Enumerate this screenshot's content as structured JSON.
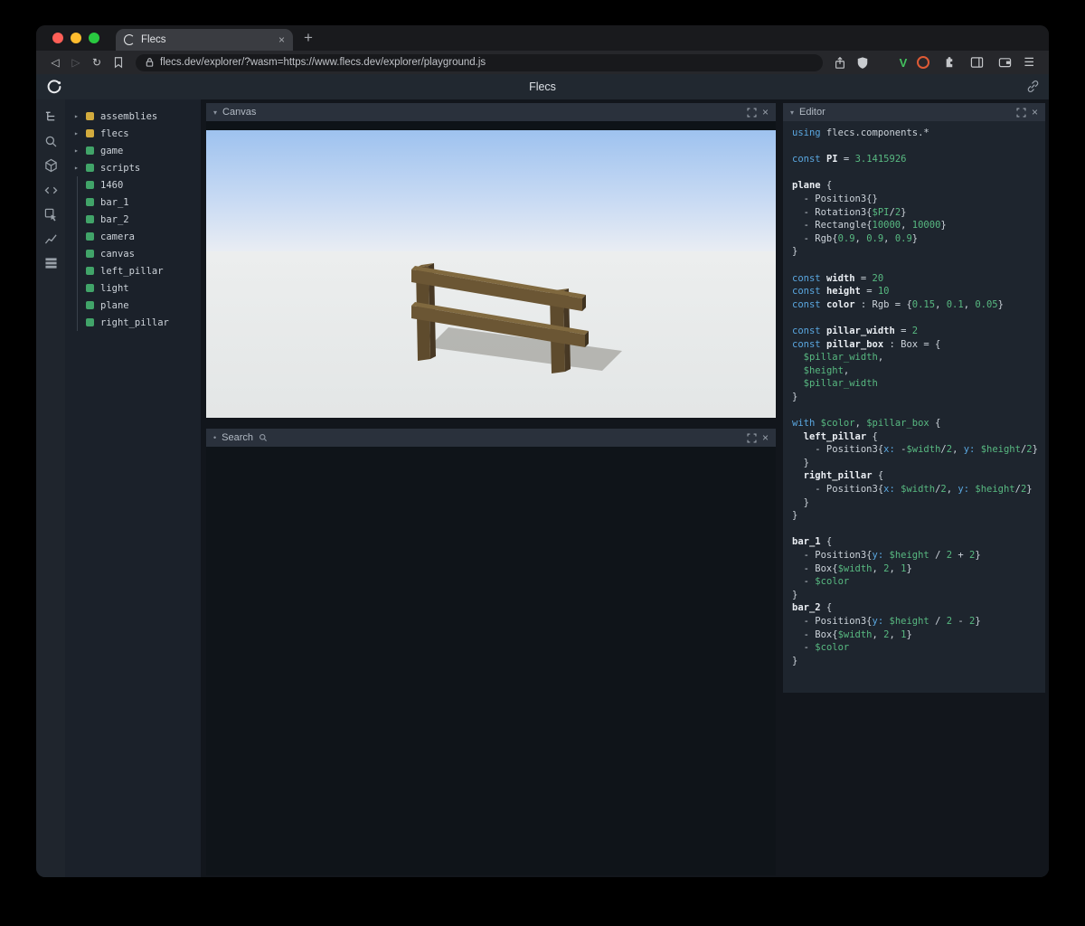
{
  "colors": {
    "module_icon": "#d2ab3e",
    "entity_icon": "#41a469",
    "code_keyword": "#5aa7e0",
    "code_value": "#58b981",
    "sky": "#9ec2ef",
    "ground": "#e9ebeb",
    "wood_front": "#6b5634"
  },
  "browser": {
    "tab_title": "Flecs",
    "url": "flecs.dev/explorer/?wasm=https://www.flecs.dev/explorer/playground.js",
    "icons": {
      "back": "◁",
      "forward": "▷",
      "reload": "↻",
      "new_tab": "+",
      "tab_close": "×",
      "menu": "☰",
      "v_extension": "V"
    }
  },
  "page": {
    "title": "Flecs"
  },
  "panels": {
    "canvas": {
      "title": "Canvas",
      "collapse_icon": "▾",
      "close_icon": "×"
    },
    "search": {
      "title": "Search",
      "bullet_icon": "•",
      "close_icon": "×"
    },
    "editor": {
      "title": "Editor",
      "collapse_icon": "▾",
      "close_icon": "×"
    }
  },
  "tree": {
    "expand_arrow": "▸",
    "items": [
      {
        "label": "assemblies",
        "kind": "module",
        "expandable": true
      },
      {
        "label": "flecs",
        "kind": "module",
        "expandable": true
      },
      {
        "label": "game",
        "kind": "entity",
        "expandable": true
      },
      {
        "label": "scripts",
        "kind": "entity",
        "expandable": true
      },
      {
        "label": "1460",
        "kind": "entity",
        "expandable": false
      },
      {
        "label": "bar_1",
        "kind": "entity",
        "expandable": false
      },
      {
        "label": "bar_2",
        "kind": "entity",
        "expandable": false
      },
      {
        "label": "camera",
        "kind": "entity",
        "expandable": false
      },
      {
        "label": "canvas",
        "kind": "entity",
        "expandable": false
      },
      {
        "label": "left_pillar",
        "kind": "entity",
        "expandable": false
      },
      {
        "label": "light",
        "kind": "entity",
        "expandable": false
      },
      {
        "label": "plane",
        "kind": "entity",
        "expandable": false
      },
      {
        "label": "right_pillar",
        "kind": "entity",
        "expandable": false
      }
    ]
  },
  "editor_code": {
    "lines": [
      [
        [
          "using",
          "k"
        ],
        [
          " flecs.components.*",
          "t"
        ]
      ],
      [],
      [
        [
          "const",
          "k"
        ],
        [
          " ",
          "t"
        ],
        [
          "PI",
          "d"
        ],
        [
          " = ",
          "t"
        ],
        [
          "3.1415926",
          "n"
        ]
      ],
      [],
      [
        [
          "plane",
          "d"
        ],
        [
          " {",
          "t"
        ]
      ],
      [
        [
          "  - Position3{}",
          "t"
        ]
      ],
      [
        [
          "  - Rotation3{",
          "t"
        ],
        [
          "$PI",
          "v"
        ],
        [
          "/",
          "t"
        ],
        [
          "2",
          "n"
        ],
        [
          "}",
          "t"
        ]
      ],
      [
        [
          "  - Rectangle{",
          "t"
        ],
        [
          "10000",
          "n"
        ],
        [
          ", ",
          "t"
        ],
        [
          "10000",
          "n"
        ],
        [
          "}",
          "t"
        ]
      ],
      [
        [
          "  - Rgb{",
          "t"
        ],
        [
          "0.9",
          "n"
        ],
        [
          ", ",
          "t"
        ],
        [
          "0.9",
          "n"
        ],
        [
          ", ",
          "t"
        ],
        [
          "0.9",
          "n"
        ],
        [
          "}",
          "t"
        ]
      ],
      [
        [
          "}",
          "t"
        ]
      ],
      [],
      [
        [
          "const",
          "k"
        ],
        [
          " ",
          "t"
        ],
        [
          "width",
          "d"
        ],
        [
          " = ",
          "t"
        ],
        [
          "20",
          "n"
        ]
      ],
      [
        [
          "const",
          "k"
        ],
        [
          " ",
          "t"
        ],
        [
          "height",
          "d"
        ],
        [
          " = ",
          "t"
        ],
        [
          "10",
          "n"
        ]
      ],
      [
        [
          "const",
          "k"
        ],
        [
          " ",
          "t"
        ],
        [
          "color",
          "d"
        ],
        [
          " : Rgb = {",
          "t"
        ],
        [
          "0.15",
          "n"
        ],
        [
          ", ",
          "t"
        ],
        [
          "0.1",
          "n"
        ],
        [
          ", ",
          "t"
        ],
        [
          "0.05",
          "n"
        ],
        [
          "}",
          "t"
        ]
      ],
      [],
      [
        [
          "const",
          "k"
        ],
        [
          " ",
          "t"
        ],
        [
          "pillar_width",
          "d"
        ],
        [
          " = ",
          "t"
        ],
        [
          "2",
          "n"
        ]
      ],
      [
        [
          "const",
          "k"
        ],
        [
          " ",
          "t"
        ],
        [
          "pillar_box",
          "d"
        ],
        [
          " : Box = {",
          "t"
        ]
      ],
      [
        [
          "  ",
          "t"
        ],
        [
          "$pillar_width",
          "v"
        ],
        [
          ",",
          "t"
        ]
      ],
      [
        [
          "  ",
          "t"
        ],
        [
          "$height",
          "v"
        ],
        [
          ",",
          "t"
        ]
      ],
      [
        [
          "  ",
          "t"
        ],
        [
          "$pillar_width",
          "v"
        ]
      ],
      [
        [
          "}",
          "t"
        ]
      ],
      [],
      [
        [
          "with",
          "k"
        ],
        [
          " ",
          "t"
        ],
        [
          "$color",
          "v"
        ],
        [
          ", ",
          "t"
        ],
        [
          "$pillar_box",
          "v"
        ],
        [
          " {",
          "t"
        ]
      ],
      [
        [
          "  ",
          "t"
        ],
        [
          "left_pillar",
          "d"
        ],
        [
          " {",
          "t"
        ]
      ],
      [
        [
          "    - Position3{",
          "t"
        ],
        [
          "x:",
          "p"
        ],
        [
          " -",
          "t"
        ],
        [
          "$width",
          "v"
        ],
        [
          "/",
          "t"
        ],
        [
          "2",
          "n"
        ],
        [
          ", ",
          "t"
        ],
        [
          "y:",
          "p"
        ],
        [
          " ",
          "t"
        ],
        [
          "$height",
          "v"
        ],
        [
          "/",
          "t"
        ],
        [
          "2",
          "n"
        ],
        [
          "}",
          "t"
        ]
      ],
      [
        [
          "  }",
          "t"
        ]
      ],
      [
        [
          "  ",
          "t"
        ],
        [
          "right_pillar",
          "d"
        ],
        [
          " {",
          "t"
        ]
      ],
      [
        [
          "    - Position3{",
          "t"
        ],
        [
          "x:",
          "p"
        ],
        [
          " ",
          "t"
        ],
        [
          "$width",
          "v"
        ],
        [
          "/",
          "t"
        ],
        [
          "2",
          "n"
        ],
        [
          ", ",
          "t"
        ],
        [
          "y:",
          "p"
        ],
        [
          " ",
          "t"
        ],
        [
          "$height",
          "v"
        ],
        [
          "/",
          "t"
        ],
        [
          "2",
          "n"
        ],
        [
          "}",
          "t"
        ]
      ],
      [
        [
          "  }",
          "t"
        ]
      ],
      [
        [
          "}",
          "t"
        ]
      ],
      [],
      [
        [
          "bar_1",
          "d"
        ],
        [
          " {",
          "t"
        ]
      ],
      [
        [
          "  - Position3{",
          "t"
        ],
        [
          "y:",
          "p"
        ],
        [
          " ",
          "t"
        ],
        [
          "$height",
          "v"
        ],
        [
          " / ",
          "t"
        ],
        [
          "2",
          "n"
        ],
        [
          " + ",
          "t"
        ],
        [
          "2",
          "n"
        ],
        [
          "}",
          "t"
        ]
      ],
      [
        [
          "  - Box{",
          "t"
        ],
        [
          "$width",
          "v"
        ],
        [
          ", ",
          "t"
        ],
        [
          "2",
          "n"
        ],
        [
          ", ",
          "t"
        ],
        [
          "1",
          "n"
        ],
        [
          "}",
          "t"
        ]
      ],
      [
        [
          "  - ",
          "t"
        ],
        [
          "$color",
          "v"
        ]
      ],
      [
        [
          "}",
          "t"
        ]
      ],
      [
        [
          "bar_2",
          "d"
        ],
        [
          " {",
          "t"
        ]
      ],
      [
        [
          "  - Position3{",
          "t"
        ],
        [
          "y:",
          "p"
        ],
        [
          " ",
          "t"
        ],
        [
          "$height",
          "v"
        ],
        [
          " / ",
          "t"
        ],
        [
          "2",
          "n"
        ],
        [
          " - ",
          "t"
        ],
        [
          "2",
          "n"
        ],
        [
          "}",
          "t"
        ]
      ],
      [
        [
          "  - Box{",
          "t"
        ],
        [
          "$width",
          "v"
        ],
        [
          ", ",
          "t"
        ],
        [
          "2",
          "n"
        ],
        [
          ", ",
          "t"
        ],
        [
          "1",
          "n"
        ],
        [
          "}",
          "t"
        ]
      ],
      [
        [
          "  - ",
          "t"
        ],
        [
          "$color",
          "v"
        ]
      ],
      [
        [
          "}",
          "t"
        ]
      ]
    ]
  }
}
